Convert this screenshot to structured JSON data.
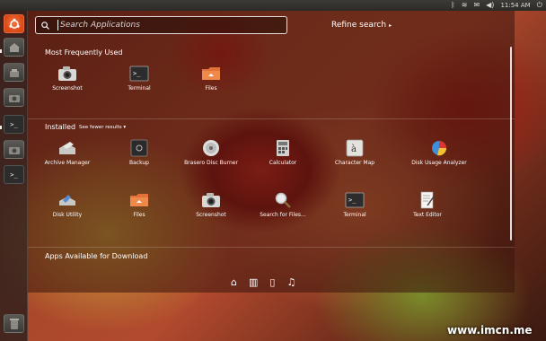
{
  "panel": {
    "indicators": [
      "bluetooth-icon",
      "network-icon",
      "mail-icon",
      "sound-icon"
    ],
    "clock": "11:54 AM"
  },
  "launcher": {
    "items": [
      "ubuntu-logo-icon",
      "home-folder-icon",
      "files-icon",
      "camera-icon",
      "terminal-icon",
      "screenshot-icon",
      "terminal-icon",
      "trash-icon"
    ]
  },
  "search": {
    "placeholder": "Search Applications",
    "value": ""
  },
  "refine": {
    "label": "Refine search",
    "arrow": "▸"
  },
  "sections": {
    "frequent": {
      "title": "Most Frequently Used",
      "apps": [
        {
          "label": "Screenshot",
          "icon": "camera-icon"
        },
        {
          "label": "Terminal",
          "icon": "terminal-icon"
        },
        {
          "label": "Files",
          "icon": "folder-icon"
        }
      ]
    },
    "installed": {
      "title": "Installed",
      "toggle": "See fewer results",
      "apps": [
        {
          "label": "Archive Manager",
          "icon": "archive-icon"
        },
        {
          "label": "Backup",
          "icon": "safe-icon"
        },
        {
          "label": "Brasero Disc Burner",
          "icon": "disc-icon"
        },
        {
          "label": "Calculator",
          "icon": "calculator-icon"
        },
        {
          "label": "Character Map",
          "icon": "character-map-icon"
        },
        {
          "label": "Disk Usage Analyzer",
          "icon": "pie-chart-icon"
        },
        {
          "label": "Disk Utility",
          "icon": "disk-utility-icon"
        },
        {
          "label": "Files",
          "icon": "folder-icon"
        },
        {
          "label": "Screenshot",
          "icon": "camera-icon"
        },
        {
          "label": "Search for Files...",
          "icon": "magnifier-icon"
        },
        {
          "label": "Terminal",
          "icon": "terminal-icon"
        },
        {
          "label": "Text Editor",
          "icon": "text-editor-icon"
        }
      ]
    },
    "download": {
      "title": "Apps Available for Download"
    }
  },
  "filters": [
    "home-icon",
    "applications-icon",
    "files-filter-icon",
    "music-icon"
  ],
  "watermark": "www.imcn.me"
}
